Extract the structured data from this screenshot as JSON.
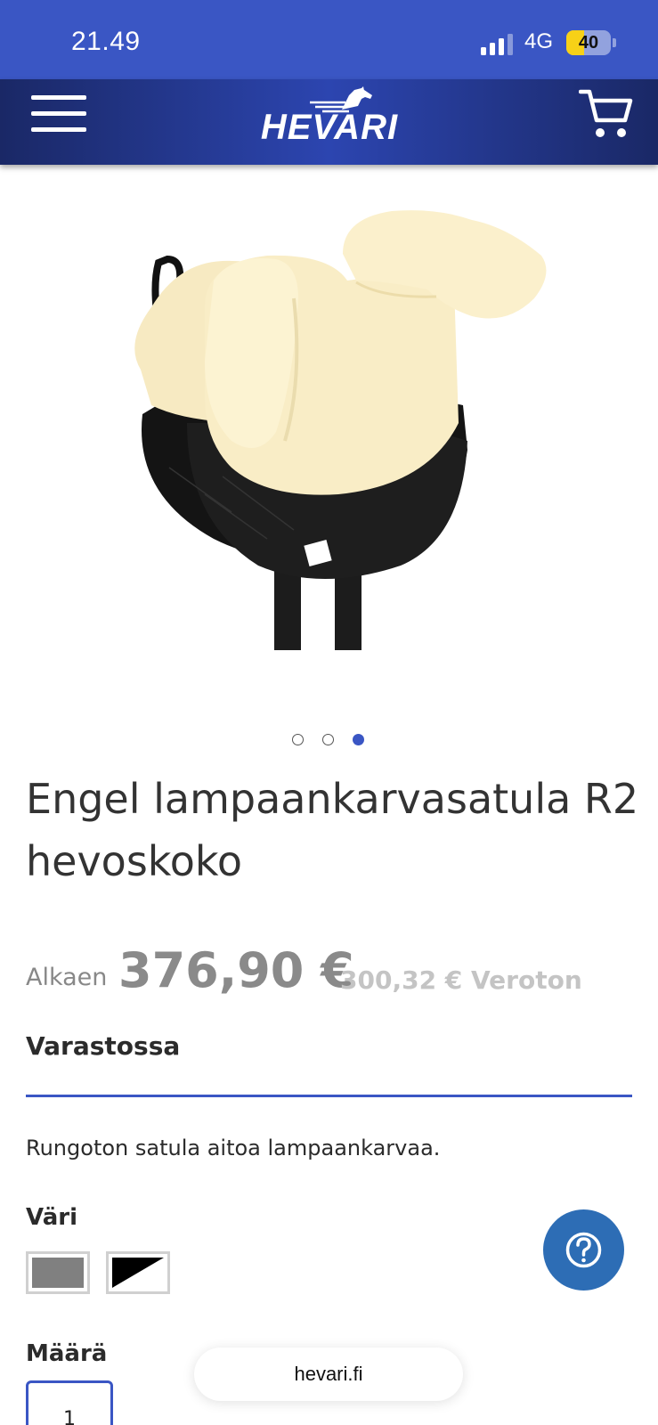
{
  "status_bar": {
    "time": "21.49",
    "network": "4G",
    "battery": "40",
    "battery_level": 0.4
  },
  "header": {
    "logo_text": "HEVARI",
    "icons": [
      "menu-icon",
      "horse-logo-icon",
      "cart-icon"
    ]
  },
  "carousel": {
    "total": 3,
    "active_index": 2
  },
  "product": {
    "title": "Engel lampaankarvasatula R2 hevoskoko",
    "price_prefix": "Alkaen",
    "price": "376,90 €",
    "price_vat_free": "300,32 € Veroton",
    "stock": "Varastossa",
    "description": "Rungoton satula aitoa lampaankarvaa."
  },
  "options": {
    "color_label": "Väri",
    "colors": [
      {
        "name": "grey",
        "hex": "#808080"
      },
      {
        "name": "black-white",
        "hex": "#000000"
      }
    ],
    "quantity_label": "Määrä",
    "quantity_value": "1"
  },
  "browser": {
    "url": "hevari.fi"
  },
  "colors": {
    "brand_blue": "#3a56c4",
    "header_dark": "#1a2866",
    "help_button": "#2d6db5"
  }
}
